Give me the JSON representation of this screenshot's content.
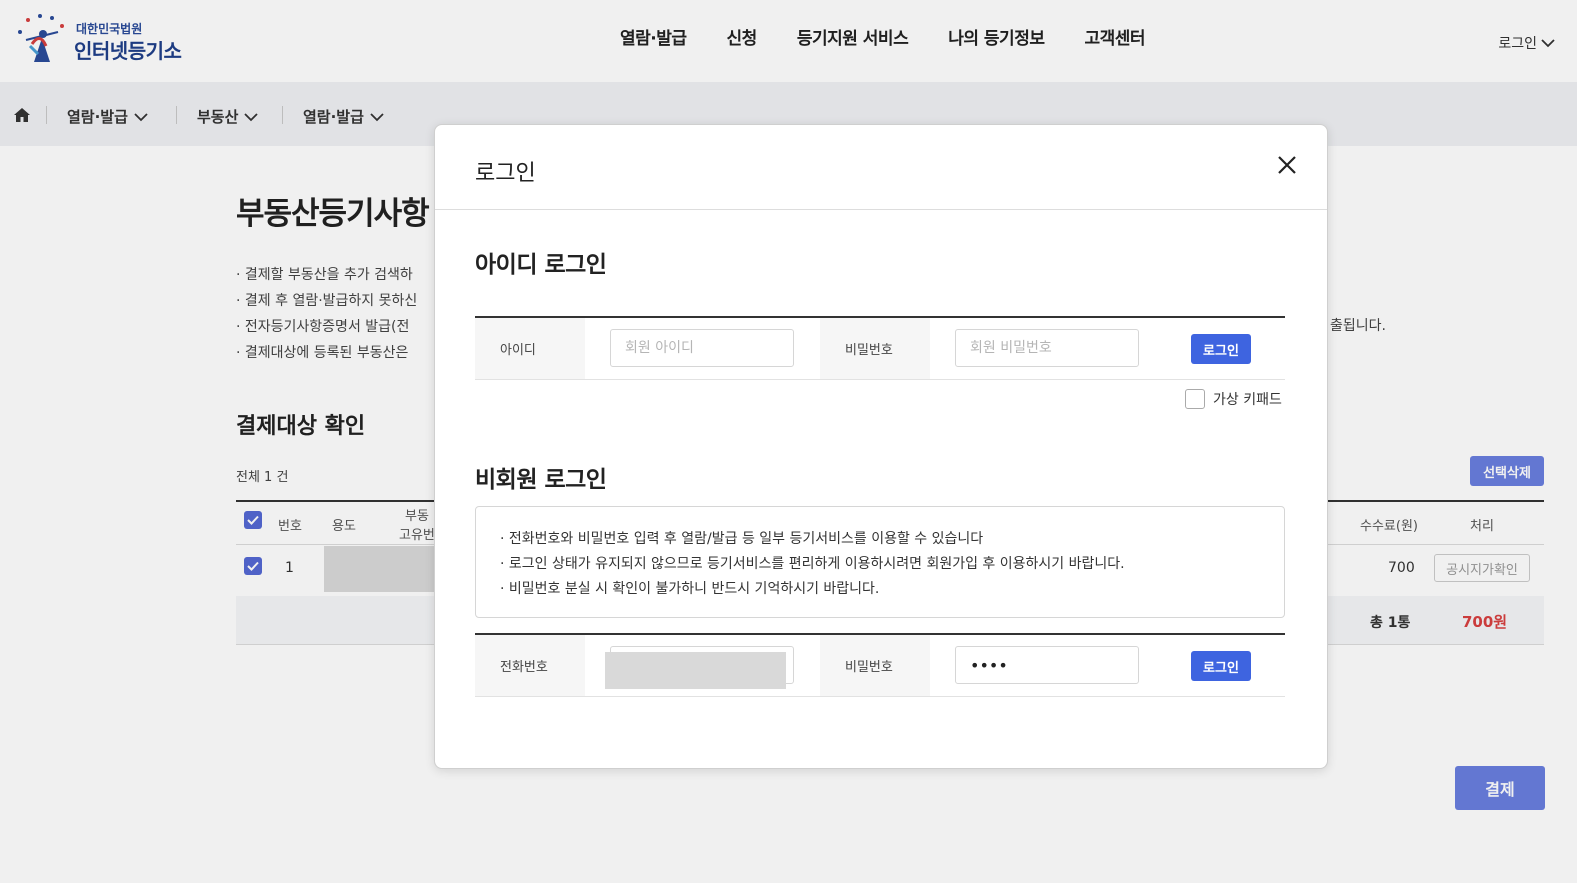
{
  "header": {
    "logo_sub": "대한민국법원",
    "logo_main": "인터넷등기소",
    "nav": [
      "열람·발급",
      "신청",
      "등기지원 서비스",
      "나의 등기정보",
      "고객센터"
    ],
    "login_link": "로그인"
  },
  "breadcrumb": [
    "열람·발급",
    "부동산",
    "열람·발급"
  ],
  "page": {
    "title": "부동산등기사항",
    "notes": [
      "· 결제할 부동산을 추가 검색하",
      "· 결제 후 열람·발급하지 못하신",
      "· 전자등기사항증명서 발급(전",
      "· 결제대상에 등록된 부동산은"
    ],
    "note_tail": "출됩니다.",
    "section_title": "결제대상 확인",
    "total_count": "전체 1 건",
    "delete_button": "선택삭제",
    "columns": {
      "num": "번호",
      "use": "용도",
      "id_line1": "부동",
      "id_line2": "고유번",
      "fee": "수수료(원)",
      "action": "처리"
    },
    "row": {
      "num": "1",
      "fragment": "",
      "fee": "700",
      "verify_button": "공시지가확인"
    },
    "summary": {
      "count": "총 1통",
      "amount": "700원"
    },
    "pay_button": "결제"
  },
  "modal": {
    "title": "로그인",
    "id_login": {
      "heading": "아이디 로그인",
      "id_label": "아이디",
      "id_placeholder": "회원 아이디",
      "pw_label": "비밀번호",
      "pw_placeholder": "회원 비밀번호",
      "button": "로그인",
      "virtual_keypad": "가상 키패드"
    },
    "guest_login": {
      "heading": "비회원 로그인",
      "info": [
        "· 전화번호와 비밀번호 입력 후 열람/발급 등 일부 등기서비스를 이용할 수 있습니다",
        "· 로그인 상태가 유지되지 않으므로 등기서비스를 편리하게 이용하시려면 회원가입 후 이용하시기 바랍니다.",
        "· 비밀번호 분실 시 확인이 불가하니 반드시 기억하시기 바랍니다."
      ],
      "phone_label": "전화번호",
      "pw_label": "비밀번호",
      "pw_value": "••••",
      "button": "로그인"
    }
  },
  "colors": {
    "primary": "#3e64e0",
    "accent_soft": "#6a7fe0",
    "amount_red": "#d84040"
  }
}
